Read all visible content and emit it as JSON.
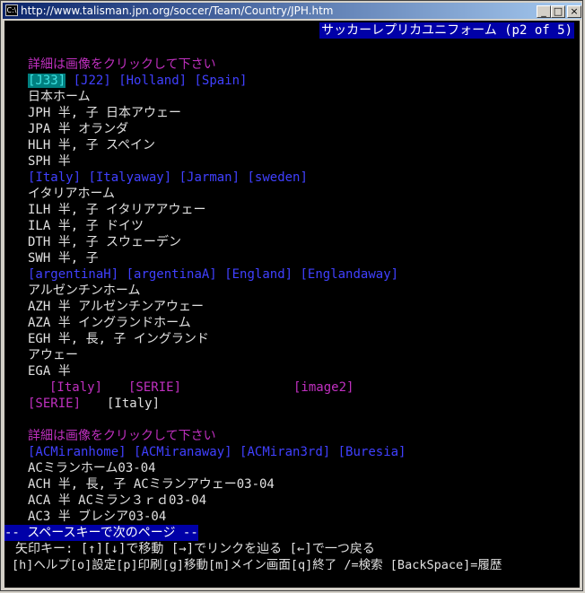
{
  "window": {
    "title": "http://www.talisman.jpn.org/soccer/Team/Country/JPH.htm",
    "icon_label": "C:\\",
    "buttons": {
      "minimize": "_",
      "maximize": "□",
      "close": "×"
    }
  },
  "header": "サッカーレプリカユニフォーム (p2 of 5)",
  "content": {
    "section1_caption": "詳細は画像をクリックして下さい",
    "links_row1": [
      "[J33]",
      "[J22]",
      "[Holland]",
      "[Spain]"
    ],
    "lines1": [
      "日本ホーム",
      "JPH 半, 子 日本アウェー",
      "JPA 半 オランダ",
      "HLH 半, 子 スペイン",
      "SPH 半"
    ],
    "links_row2": [
      "[Italy]",
      "[Italyaway]",
      "[Jarman]",
      "[sweden]"
    ],
    "lines2": [
      "イタリアホーム",
      "ILH 半, 子 イタリアアウェー",
      "ILA 半, 子 ドイツ",
      "DTH 半, 子 スウェーデン",
      "SWH 半, 子"
    ],
    "links_row3": [
      "[argentinaH]",
      "[argentinaA]",
      "[England]",
      "[Englandaway]"
    ],
    "lines3": [
      "アルゼンチンホーム",
      "AZH 半 アルゼンチンアウェー",
      "AZA 半 イングランドホーム",
      "EGH 半, 長, 子 イングランド",
      "アウェー",
      "EGA 半"
    ],
    "row_italy": {
      "a": "[Italy]",
      "b": "[SERIE]",
      "c": "[image2]"
    },
    "row_serie": {
      "a": "[SERIE]",
      "b": "[Italy]"
    },
    "section2_caption": "詳細は画像をクリックして下さい",
    "links_row4": [
      "[ACMiranhome]",
      "[ACMiranaway]",
      "[ACMiran3rd]",
      "[Buresia]"
    ],
    "lines4": [
      "ACミランホーム03-04",
      "ACH 半, 長, 子 ACミランアウェー03-04",
      "ACA 半 ACミラン３ｒｄ03-04",
      "AC3 半 ブレシア03-04"
    ]
  },
  "status_line": "-- スペースキーで次のページ --",
  "help_line1": "矢印キー: [↑][↓]で移動 [→]でリンクを辿る [←]で一つ戻る",
  "help_line2": "[h]ヘルプ[o]設定[p]印刷[g]移動[m]メイン画面[q]終了 /=検索 [BackSpace]=履歴"
}
